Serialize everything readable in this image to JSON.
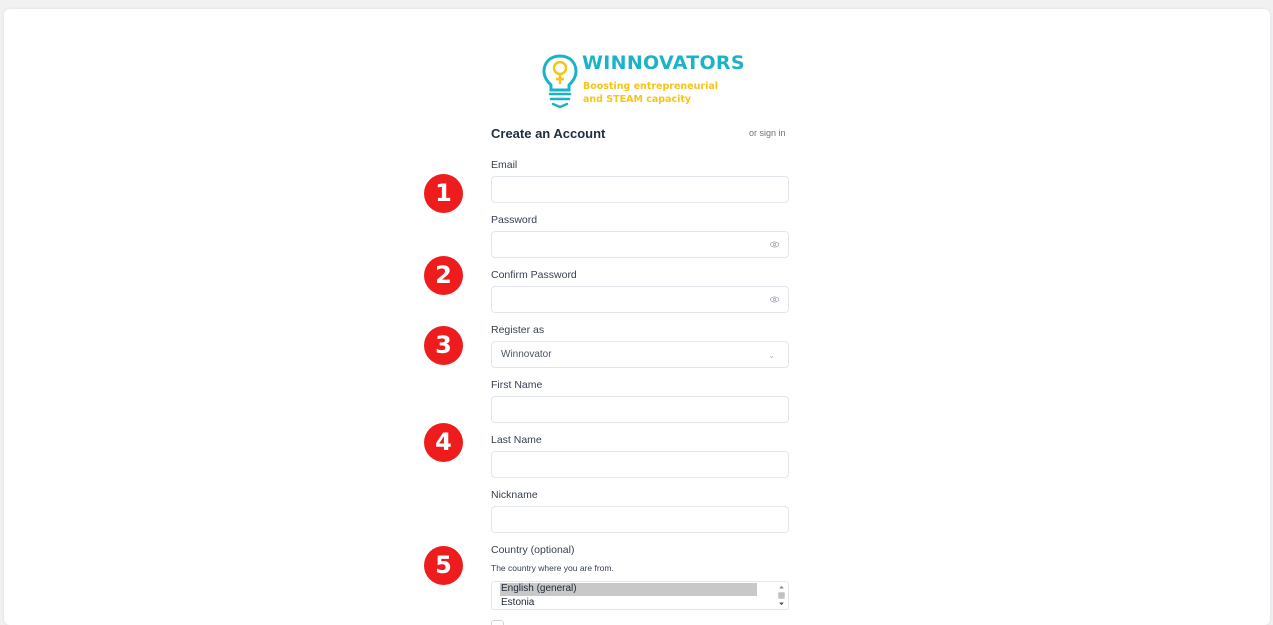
{
  "brand": {
    "name": "WINNOVATORS",
    "tagline_line1": "Boosting entrepreneurial",
    "tagline_line2": "and STEAM capacity"
  },
  "form": {
    "title": "Create an Account",
    "signin_link": "or sign in",
    "email": {
      "label": "Email",
      "value": ""
    },
    "password": {
      "label": "Password",
      "value": ""
    },
    "confirm_password": {
      "label": "Confirm Password",
      "value": ""
    },
    "register_as": {
      "label": "Register as",
      "selected": "Winnovator"
    },
    "first_name": {
      "label": "First Name",
      "value": ""
    },
    "last_name": {
      "label": "Last Name",
      "value": ""
    },
    "nickname": {
      "label": "Nickname",
      "value": ""
    },
    "country": {
      "label": "Country (optional)",
      "hint": "The country where you are from.",
      "options": [
        "English (general)",
        "Estonia"
      ]
    }
  },
  "annotations": {
    "step1": "1",
    "step2": "2",
    "step3": "3",
    "step4": "4",
    "step5": "5"
  },
  "colors": {
    "brand_teal": "#1bb3c8",
    "brand_yellow": "#f5c518",
    "annotation_red": "#ee1c1c"
  }
}
